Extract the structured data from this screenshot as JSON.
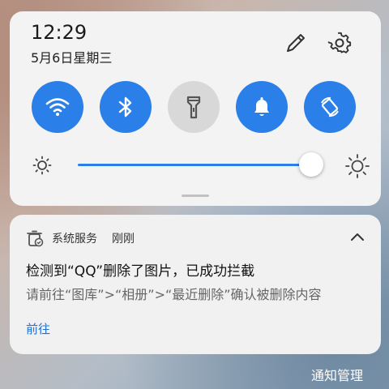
{
  "status": {
    "time": "12:29",
    "date": "5月6日星期三"
  },
  "header_icons": [
    "edit-pencil-icon",
    "settings-gear-icon"
  ],
  "quick_tiles": [
    {
      "name": "wifi",
      "icon": "wifi-icon",
      "active": true
    },
    {
      "name": "bluetooth",
      "icon": "bluetooth-icon",
      "active": true
    },
    {
      "name": "flashlight",
      "icon": "flashlight-icon",
      "active": false
    },
    {
      "name": "sound",
      "icon": "bell-icon",
      "active": true
    },
    {
      "name": "auto-rotate",
      "icon": "rotate-icon",
      "active": true
    }
  ],
  "brightness": {
    "level": 1.0
  },
  "notification": {
    "app_name": "系统服务",
    "time": "刚刚",
    "title": "检测到“QQ”删除了图片，已成功拦截",
    "body": "请前往“图库”>“相册”>“最近删除”确认被删除内容",
    "action_label": "前往"
  },
  "footer": {
    "manage_label": "通知管理"
  },
  "colors": {
    "accent": "#2b7fe8",
    "tile_off": "#d8d8d8",
    "link": "#1f6fd6"
  }
}
